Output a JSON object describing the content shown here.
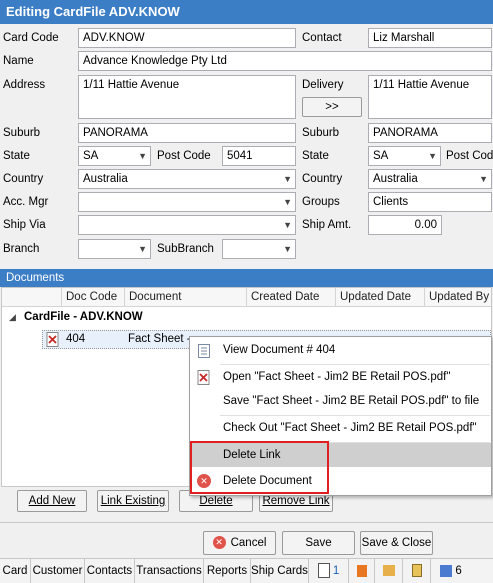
{
  "window": {
    "title": "Editing CardFile ADV.KNOW"
  },
  "form": {
    "card_code_label": "Card Code",
    "card_code": "ADV.KNOW",
    "contact_label": "Contact",
    "contact": "Liz Marshall",
    "name_label": "Name",
    "name": "Advance Knowledge Pty Ltd",
    "address_label": "Address",
    "address": "1/11 Hattie Avenue",
    "delivery_label": "Delivery",
    "delivery": "1/11 Hattie Avenue",
    "copy_button": ">>",
    "suburb_label": "Suburb",
    "suburb": "PANORAMA",
    "suburb2_label": "Suburb",
    "suburb2": "PANORAMA",
    "state_label": "State",
    "state": "SA",
    "postcode_label": "Post Code",
    "postcode": "5041",
    "state2_label": "State",
    "state2": "SA",
    "postcode2_label": "Post Code",
    "country_label": "Country",
    "country": "Australia",
    "country2_label": "Country",
    "country2": "Australia",
    "accmgr_label": "Acc. Mgr",
    "accmgr": "",
    "groups_label": "Groups",
    "groups": "Clients",
    "shipvia_label": "Ship Via",
    "shipvia": "",
    "shipamt_label": "Ship Amt.",
    "shipamt": "0.00",
    "branch_label": "Branch",
    "branch": "",
    "subbranch_label": "SubBranch",
    "subbranch": ""
  },
  "documents": {
    "section_title": "Documents",
    "columns": [
      "Doc Code",
      "Document",
      "Created Date",
      "Updated Date",
      "Updated By"
    ],
    "group_label": "CardFile - ADV.KNOW",
    "row": {
      "doc_code": "404",
      "document": "Fact Sheet -"
    }
  },
  "context_menu": {
    "items": [
      {
        "label": "View Document # 404",
        "icon": "document-icon"
      },
      {
        "label": "Open \"Fact Sheet - Jim2 BE Retail POS.pdf\"",
        "icon": "pdf-icon"
      },
      {
        "label": "Save \"Fact Sheet - Jim2 BE Retail POS.pdf\" to file",
        "icon": ""
      },
      {
        "label": "Check Out \"Fact Sheet - Jim2 BE Retail POS.pdf\"",
        "icon": ""
      },
      {
        "label": "Delete Link",
        "icon": ""
      },
      {
        "label": "Delete Document",
        "icon": "delete-icon"
      }
    ],
    "highlighted": "Delete Link"
  },
  "doc_buttons": {
    "add_new": "Add New",
    "link_existing": "Link Existing",
    "delete": "Delete",
    "remove_link": "Remove Link"
  },
  "footer_buttons": {
    "cancel": "Cancel",
    "save": "Save",
    "save_close": "Save & Close"
  },
  "tabs": [
    "Card",
    "Customer",
    "Contacts",
    "Transactions",
    "Reports",
    "Ship Cards"
  ],
  "tab_counts": {
    "notes": "1",
    "attachments": "6"
  },
  "colors": {
    "title_bar": "#3c7ec6",
    "highlight_box": "#e02020"
  }
}
